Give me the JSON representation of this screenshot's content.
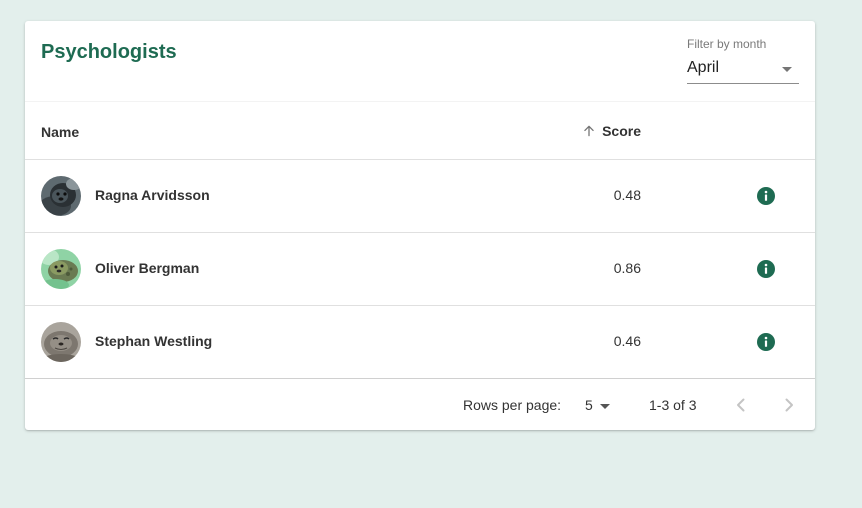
{
  "header": {
    "title": "Psychologists",
    "filter": {
      "label": "Filter by month",
      "value": "April"
    }
  },
  "table": {
    "columns": {
      "name": "Name",
      "score": "Score"
    },
    "sort": {
      "column": "score",
      "direction": "ascending",
      "icon": "arrow-up-icon"
    },
    "rows": [
      {
        "name": "Ragna Arvidsson",
        "score": "0.48",
        "avatar": "seal-photo-dark",
        "action_icon": "info-icon"
      },
      {
        "name": "Oliver Bergman",
        "score": "0.86",
        "avatar": "seal-photo-green",
        "action_icon": "info-icon"
      },
      {
        "name": "Stephan Westling",
        "score": "0.46",
        "avatar": "seal-photo-grey",
        "action_icon": "info-icon"
      }
    ]
  },
  "pagination": {
    "rows_per_page_label": "Rows per page:",
    "rows_per_page_value": "5",
    "range": "1-3 of 3",
    "prev_icon": "chevron-left-icon",
    "next_icon": "chevron-right-icon"
  },
  "colors": {
    "accent": "#1e6b52",
    "background": "#e3efec",
    "info_icon": "#1e6b52"
  }
}
